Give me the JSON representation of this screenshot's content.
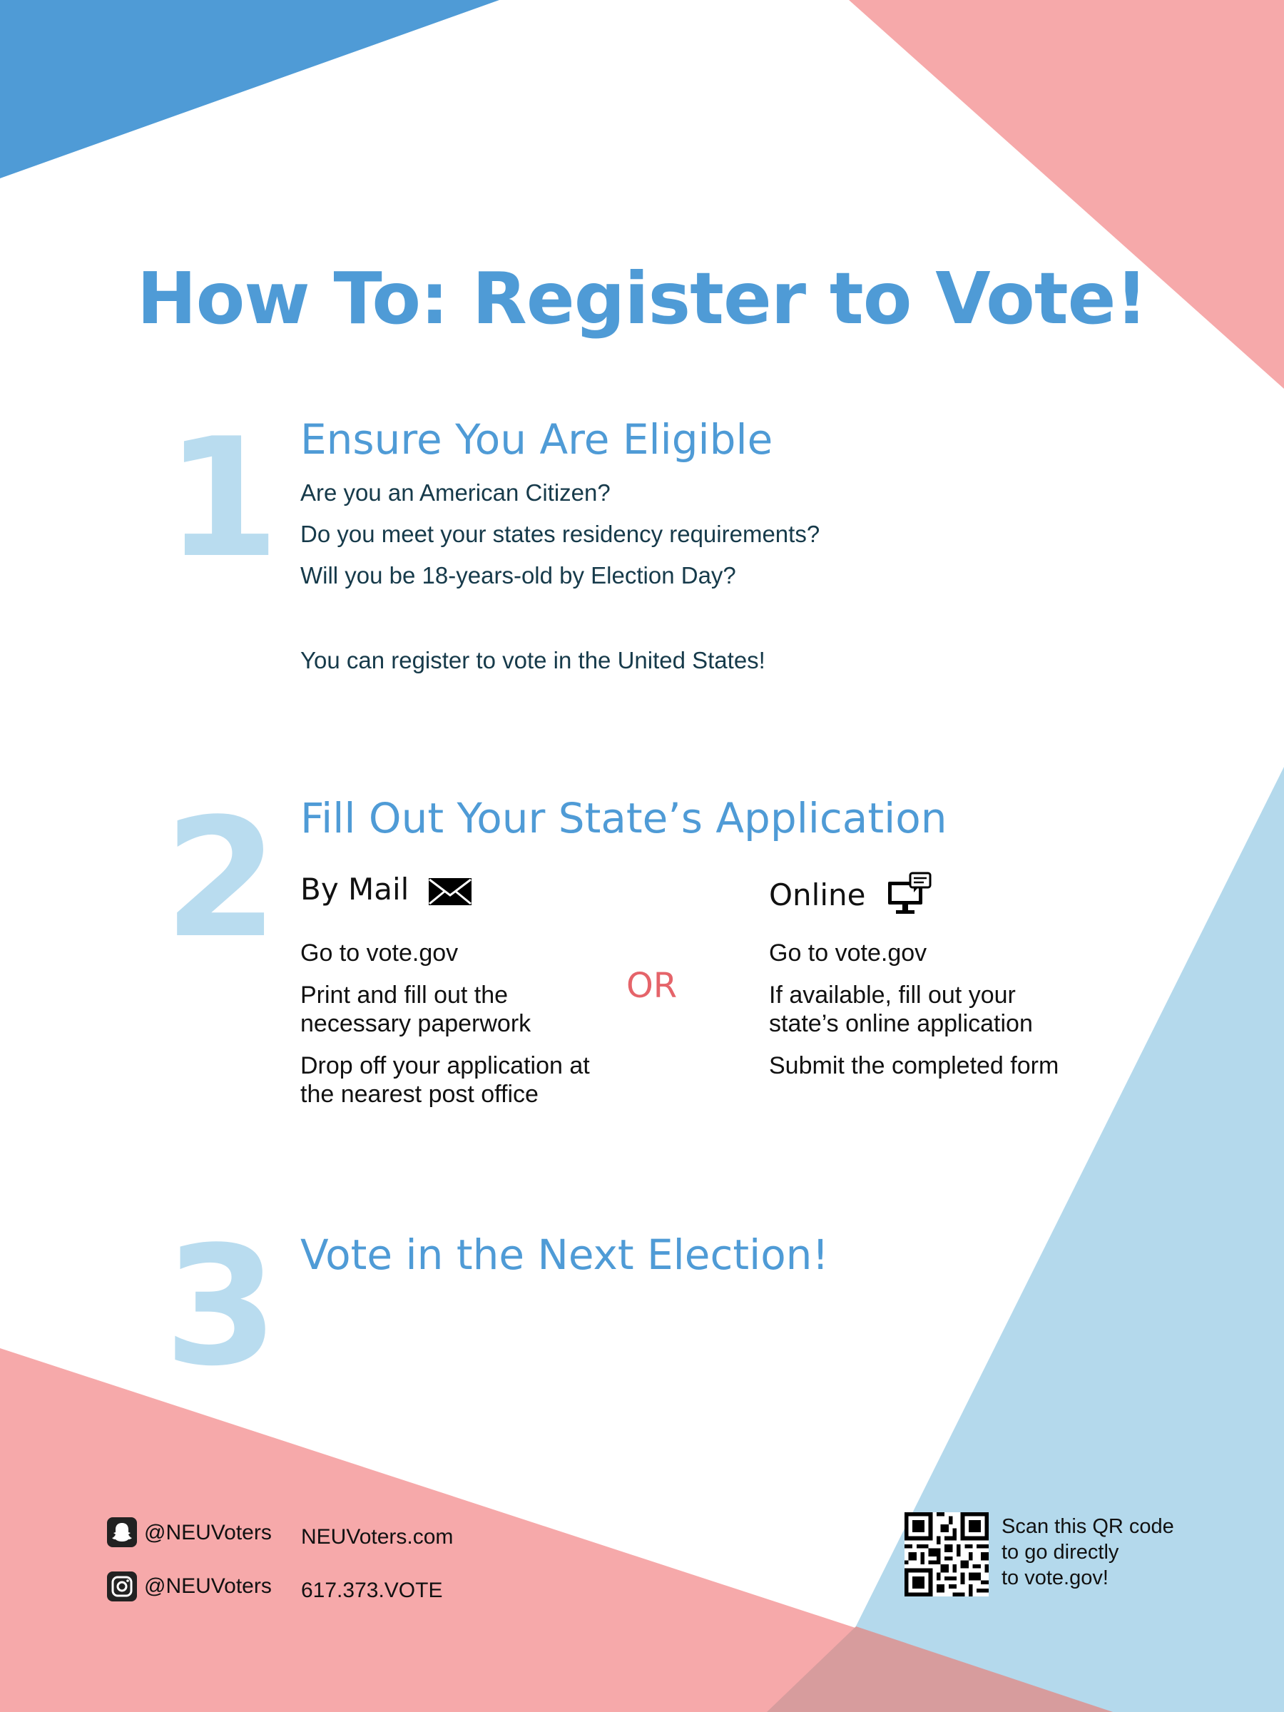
{
  "title": "How To: Register to Vote!",
  "step1": {
    "number": "1",
    "heading": "Ensure You Are Eligible",
    "questions": [
      "Are you an American Citizen?",
      "Do you meet your states residency requirements?",
      "Will you be 18-years-old by Election Day?"
    ],
    "conclusion": "You can register to vote in the United States!"
  },
  "step2": {
    "number": "2",
    "heading": "Fill Out Your State’s Application",
    "mail": {
      "label": "By Mail",
      "icon": "envelope-icon",
      "steps": [
        "Go to vote.gov",
        "Print and fill out the necessary paperwork",
        "Drop off your application at the nearest post office"
      ]
    },
    "or": "OR",
    "online": {
      "label": "Online",
      "icon": "computer-chat-icon",
      "steps": [
        "Go to vote.gov",
        "If available, fill out your state’s online application",
        "Submit the completed form"
      ]
    }
  },
  "step3": {
    "number": "3",
    "heading": "Vote in the Next Election!"
  },
  "footer": {
    "snapchat": "@NEUVoters",
    "instagram": "@NEUVoters",
    "website": "NEUVoters.com",
    "phone": "617.373.VOTE",
    "qr_lines": [
      "Scan this QR code",
      "to go directly",
      "to vote.gov!"
    ]
  },
  "colors": {
    "blue": "#4f9bd6",
    "light_blue": "#b4d9ec",
    "pink": "#f6a9aa",
    "number": "#b9dcef",
    "or": "#e5646a"
  }
}
